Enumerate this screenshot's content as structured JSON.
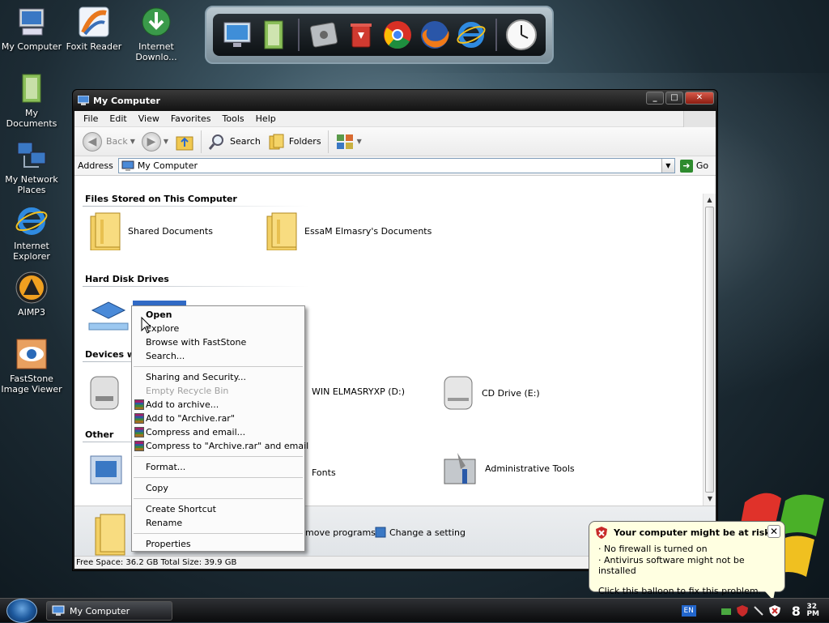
{
  "desktop": {
    "icons": [
      {
        "label": "My Computer"
      },
      {
        "label": "Foxit Reader"
      },
      {
        "label": "Internet Downlo..."
      },
      {
        "label": "My Documents"
      },
      {
        "label": "My Network Places"
      },
      {
        "label": "Internet Explorer"
      },
      {
        "label": "AIMP3"
      },
      {
        "label": "FastStone Image Viewer"
      }
    ]
  },
  "window": {
    "title": "My Computer",
    "menu": [
      "File",
      "Edit",
      "View",
      "Favorites",
      "Tools",
      "Help"
    ],
    "toolbar": {
      "back": "Back",
      "search": "Search",
      "folders": "Folders"
    },
    "address": {
      "label": "Address",
      "value": "My Computer",
      "go": "Go"
    },
    "groups": {
      "files": "Files Stored on This Computer",
      "hdd": "Hard Disk Drives",
      "devices": "Devices w",
      "other": "Other"
    },
    "items": {
      "shared": "Shared Documents",
      "user_docs": "EssaM Elmasry's Documents",
      "drive_d": "WIN ELMASRYXP (D:)",
      "drive_e": "CD Drive (E:)",
      "fonts": "Fonts",
      "admin_tools": "Administrative Tools"
    },
    "details": {
      "remove_programs": "move programs",
      "change_setting": "Change a setting"
    },
    "status": "Free Space: 36.2 GB  Total Size: 39.9 GB"
  },
  "context_menu": {
    "open": "Open",
    "explore": "Explore",
    "browse": "Browse with FastStone",
    "search": "Search...",
    "sharing": "Sharing and Security...",
    "empty_bin": "Empty Recycle Bin",
    "add_archive": "Add to archive...",
    "add_rar": "Add to \"Archive.rar\"",
    "compress_email": "Compress and email...",
    "compress_rar_email": "Compress to \"Archive.rar\" and email",
    "format": "Format...",
    "copy": "Copy",
    "shortcut": "Create Shortcut",
    "rename": "Rename",
    "properties": "Properties"
  },
  "taskbar": {
    "task": "My Computer",
    "lang": "EN",
    "clock_hour": "8",
    "clock_min": "32",
    "clock_ampm": "PM"
  },
  "balloon": {
    "title": "Your computer might be at risk",
    "line1": "· No firewall is turned on",
    "line2": "· Antivirus software might not be installed",
    "line3": "Click this balloon to fix this problem."
  },
  "colors": {
    "balloon_bg": "#ffffe1",
    "titlebar": "#1a1a1a",
    "selection": "#316ac5"
  }
}
